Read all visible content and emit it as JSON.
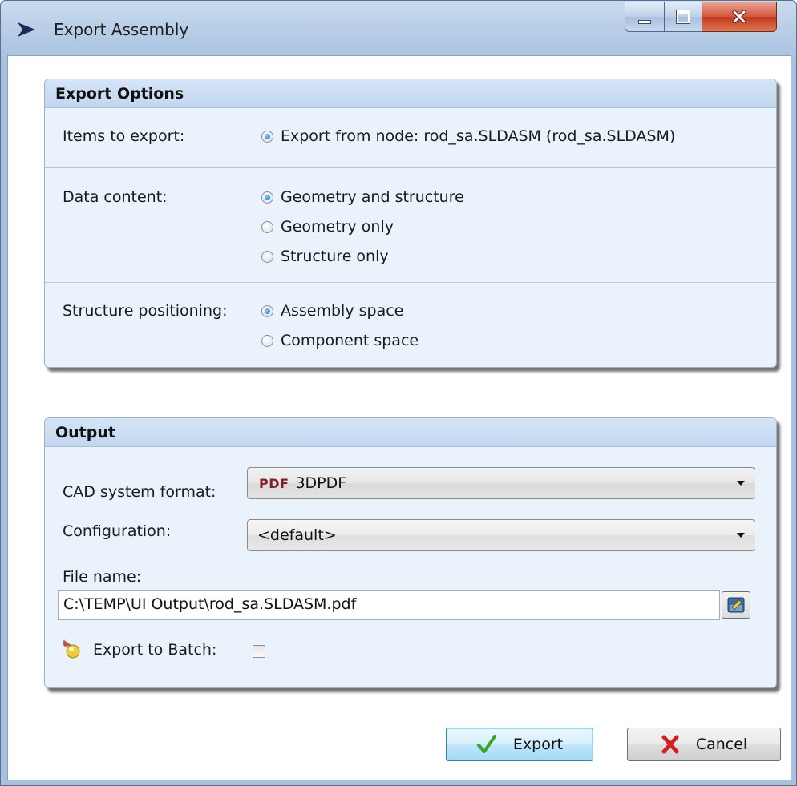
{
  "window": {
    "title": "Export Assembly"
  },
  "export_options": {
    "header": "Export Options",
    "items_label": "Items to export:",
    "items_option": "Export from node: rod_sa.SLDASM (rod_sa.SLDASM)",
    "data_content_label": "Data content:",
    "data_content_options": [
      "Geometry and structure",
      "Geometry only",
      "Structure only"
    ],
    "data_content_selected": 0,
    "positioning_label": "Structure positioning:",
    "positioning_options": [
      "Assembly space",
      "Component space"
    ],
    "positioning_selected": 0
  },
  "output": {
    "header": "Output",
    "cad_format_label": "CAD system format:",
    "cad_format_badge": "PDF",
    "cad_format_value": "3DPDF",
    "configuration_label": "Configuration:",
    "configuration_value": "<default>",
    "file_name_label": "File name:",
    "file_name_value": "C:\\TEMP\\UI Output\\rod_sa.SLDASM.pdf",
    "batch_label": "Export to Batch:",
    "batch_checked": false
  },
  "buttons": {
    "export": "Export",
    "cancel": "Cancel"
  },
  "colors": {
    "accent": "#1a6fc0",
    "group_background": "#eaf2fb",
    "header_background": "#c9dcf2",
    "export_check": "#3aa42b",
    "cancel_x": "#d42020"
  }
}
